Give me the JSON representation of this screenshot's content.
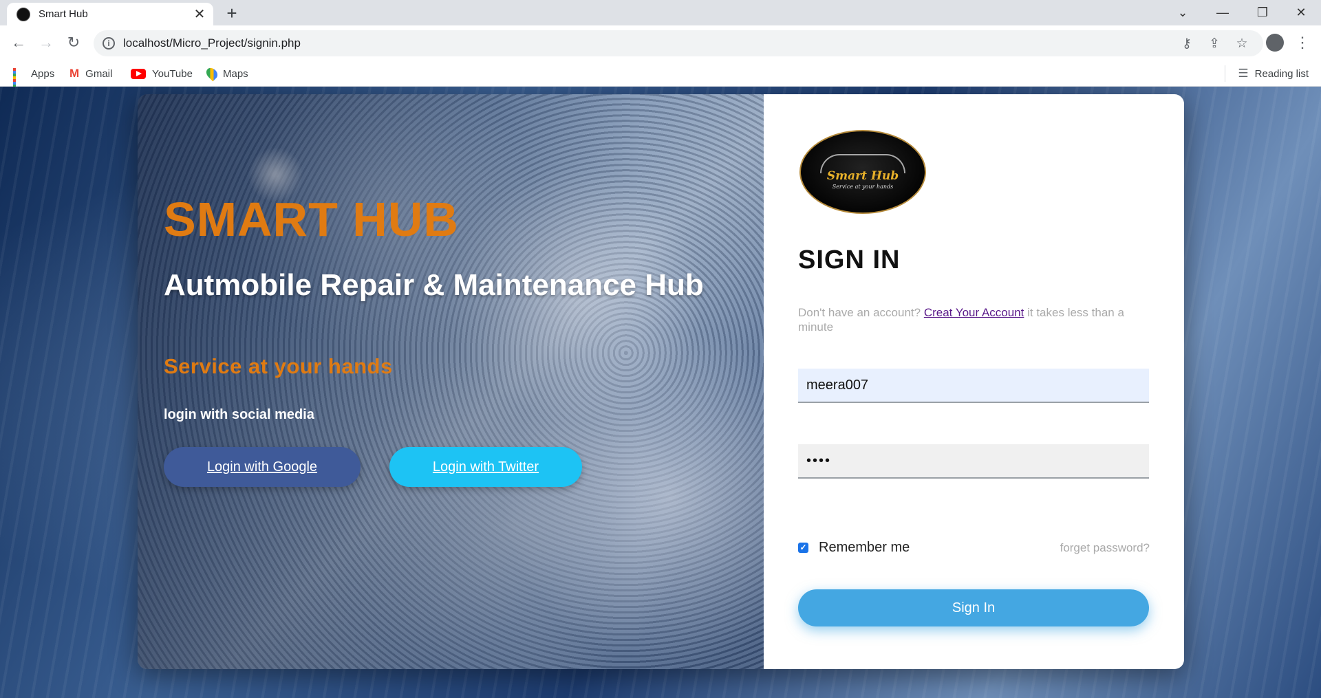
{
  "browser": {
    "tab_title": "Smart Hub",
    "tab_close": "✕",
    "new_tab": "+",
    "url": "localhost/Micro_Project/signin.php",
    "window_controls": [
      "⌄",
      "—",
      "❐",
      "✕"
    ],
    "nav": {
      "back": "←",
      "forward": "→",
      "reload": "↻"
    },
    "omnibox_icons": {
      "key": "⚷",
      "share": "⇪",
      "star": "☆"
    },
    "menu": "⋮",
    "bookmarks": [
      {
        "label": "Apps",
        "icon": "apps-grid-icon"
      },
      {
        "label": "Gmail",
        "icon": "gmail-icon"
      },
      {
        "label": "YouTube",
        "icon": "youtube-icon"
      },
      {
        "label": "Maps",
        "icon": "maps-icon"
      }
    ],
    "reading_list": "Reading list"
  },
  "hero": {
    "brand": "SMART HUB",
    "headline": "Autmobile Repair & Maintenance Hub",
    "tagline": "Service at your hands",
    "social_label": "login with social media",
    "google_button": "Login with Google",
    "twitter_button": "Login with Twitter"
  },
  "form": {
    "logo_name": "Smart Hub",
    "logo_tagline": "Service at your hands",
    "title": "SIGN IN",
    "account_prefix": "Don't have an account?",
    "account_link": "Creat Your Account",
    "account_suffix": "it takes less than a minute",
    "username_value": "meera007",
    "password_value": "••••",
    "remember_label": "Remember me",
    "remember_checked": true,
    "forget_link": "forget password?",
    "submit": "Sign In"
  },
  "colors": {
    "accent_orange": "#e07b12",
    "google_blue": "#3f5a99",
    "twitter_cyan": "#1dc3f4",
    "signin_blue": "#44a7e2",
    "link_purple": "#5a1a8a"
  }
}
